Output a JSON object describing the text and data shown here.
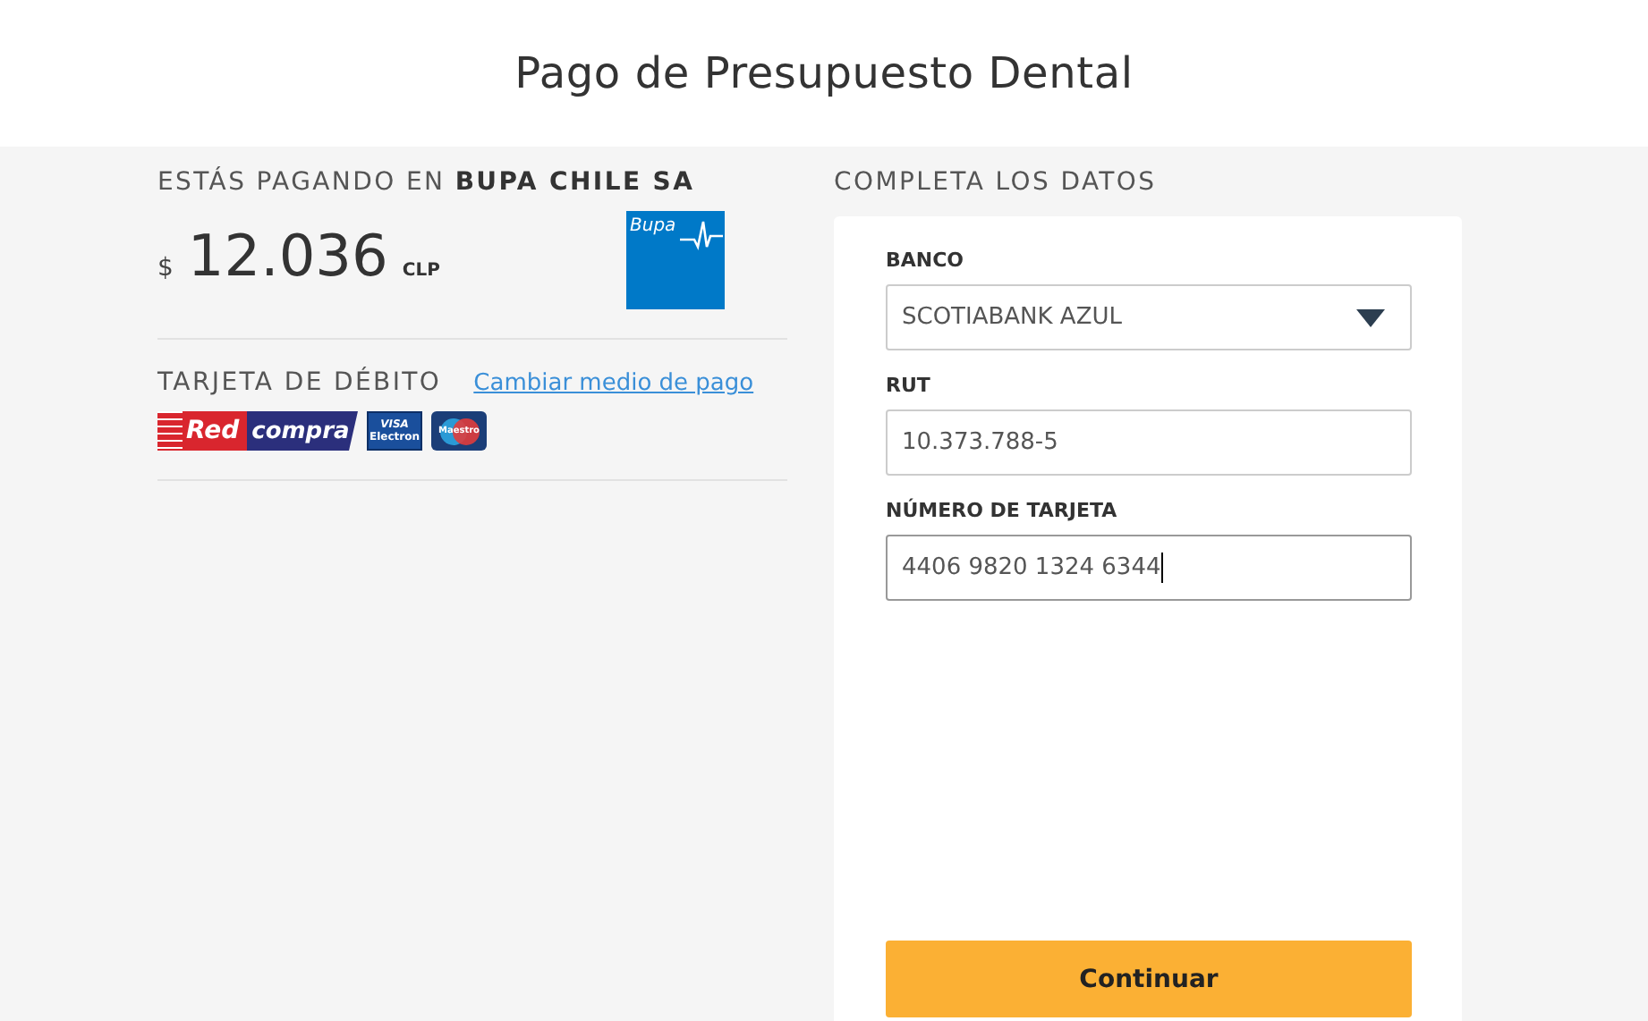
{
  "header": {
    "title": "Pago de Presupuesto Dental"
  },
  "summary": {
    "paying_label": "ESTÁS PAGANDO EN **BUPA CHILE SA**",
    "currency_symbol": "$",
    "amount": "12.036",
    "currency": "CLP",
    "merchant_logo_text": "Bupa"
  },
  "payment_method": {
    "label": "TARJETA DE DÉBITO",
    "change_link": "Cambiar medio de pago",
    "card_logos": [
      {
        "kind": "redcompra",
        "texts": [
          "Red",
          "compra"
        ]
      },
      {
        "kind": "visa-electron",
        "texts": [
          "VISA",
          "Electron"
        ]
      },
      {
        "kind": "maestro",
        "texts": [
          "Maestro"
        ]
      }
    ]
  },
  "form": {
    "heading": "COMPLETA LOS DATOS",
    "fields": [
      {
        "kind": "select",
        "label": "BANCO",
        "value": "SCOTIABANK AZUL",
        "focused": false
      },
      {
        "kind": "text",
        "label": "RUT",
        "value": "10.373.788-5",
        "focused": false
      },
      {
        "kind": "text",
        "label": "NÚMERO DE TARJETA",
        "value": "4406 9820 1324 6344",
        "focused": true
      }
    ],
    "submit": "Continuar"
  }
}
